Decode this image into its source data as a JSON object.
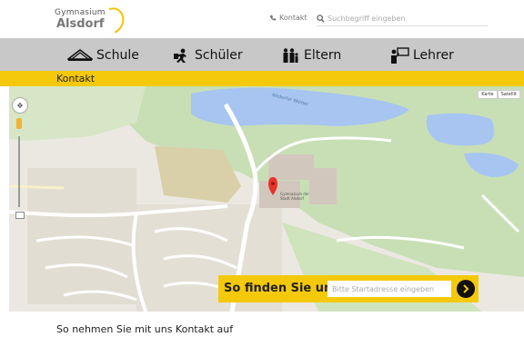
{
  "header": {
    "logo_line1": "Gymnasium",
    "logo_line2": "Alsdorf",
    "contact_label": "Kontakt",
    "search_placeholder": "Suchbegriff eingeben"
  },
  "nav": {
    "items": [
      {
        "label": "Schule",
        "icon": "school-icon"
      },
      {
        "label": "Schüler",
        "icon": "student-icon"
      },
      {
        "label": "Eltern",
        "icon": "parents-icon"
      },
      {
        "label": "Lehrer",
        "icon": "teacher-icon"
      }
    ]
  },
  "breadcrumb": {
    "current": "Kontakt"
  },
  "map": {
    "lake_label": "Alsdorfer Weiher",
    "school_label": "Gymnasium der Stadt Alsdorf",
    "map_type_buttons": [
      "Karte",
      "Satellit"
    ],
    "colors": {
      "water": "#a7c5f0",
      "park": "#c8dfb5",
      "road": "#ffffff",
      "marker": "#e8332a"
    }
  },
  "finder": {
    "label": "So finden Sie uns:",
    "placeholder": "Bitte Startadresse eingeben"
  },
  "content": {
    "section_title": "So nehmen Sie mit uns Kontakt auf"
  },
  "colors": {
    "accent": "#f5c90b",
    "nav_bg": "#c8c8c8"
  }
}
